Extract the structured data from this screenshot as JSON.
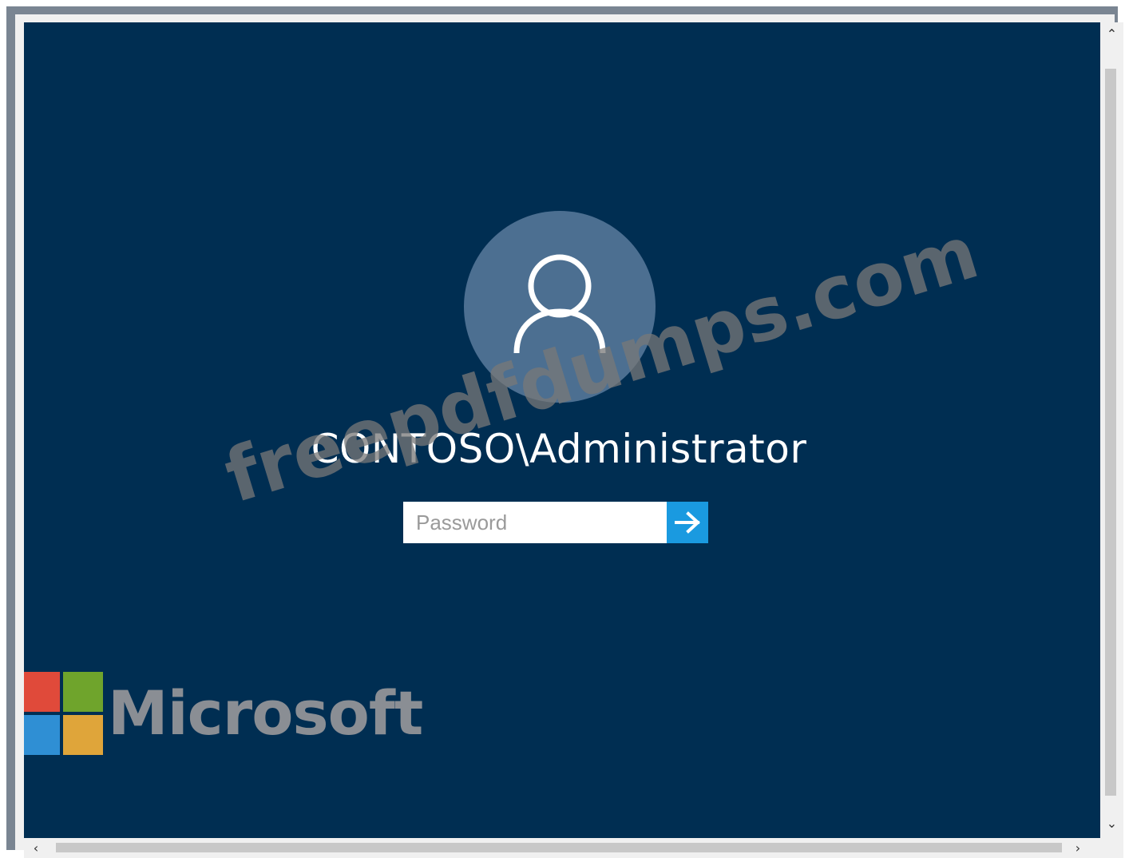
{
  "login": {
    "username": "CONTOSO\\Administrator",
    "password_placeholder": "Password",
    "submit_icon": "arrow-right-icon",
    "avatar_icon": "user-icon"
  },
  "branding": {
    "logo_text": "Microsoft",
    "logo_colors": [
      "#f25022",
      "#7fba00",
      "#00a4ef",
      "#ffb900"
    ]
  },
  "watermark": "freepdfdumps.com",
  "scrollbars": {
    "up_icon": "chevron-up-icon",
    "down_icon": "chevron-down-icon",
    "left_icon": "chevron-left-icon",
    "right_icon": "chevron-right-icon"
  },
  "colors": {
    "background": "#002e52",
    "avatar": "#4c6f91",
    "accent": "#1a9ae0"
  }
}
